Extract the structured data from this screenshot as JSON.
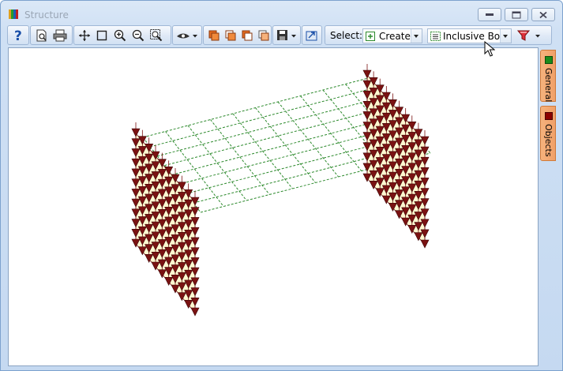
{
  "window": {
    "title": "Structure"
  },
  "toolbar": {
    "select_label": "Select:",
    "create_combo": {
      "value": "Create"
    },
    "box_combo": {
      "value": "Inclusive Box"
    }
  },
  "side_tabs": [
    {
      "label": "General",
      "color": "#1a8a1a"
    },
    {
      "label": "Objects",
      "color": "#8b0000"
    }
  ],
  "colors": {
    "load_arrow": "#7a1212",
    "panel_fill": "#fff8d0",
    "mesh_green": "#2d8a2d",
    "frame_line": "#7a1212"
  }
}
